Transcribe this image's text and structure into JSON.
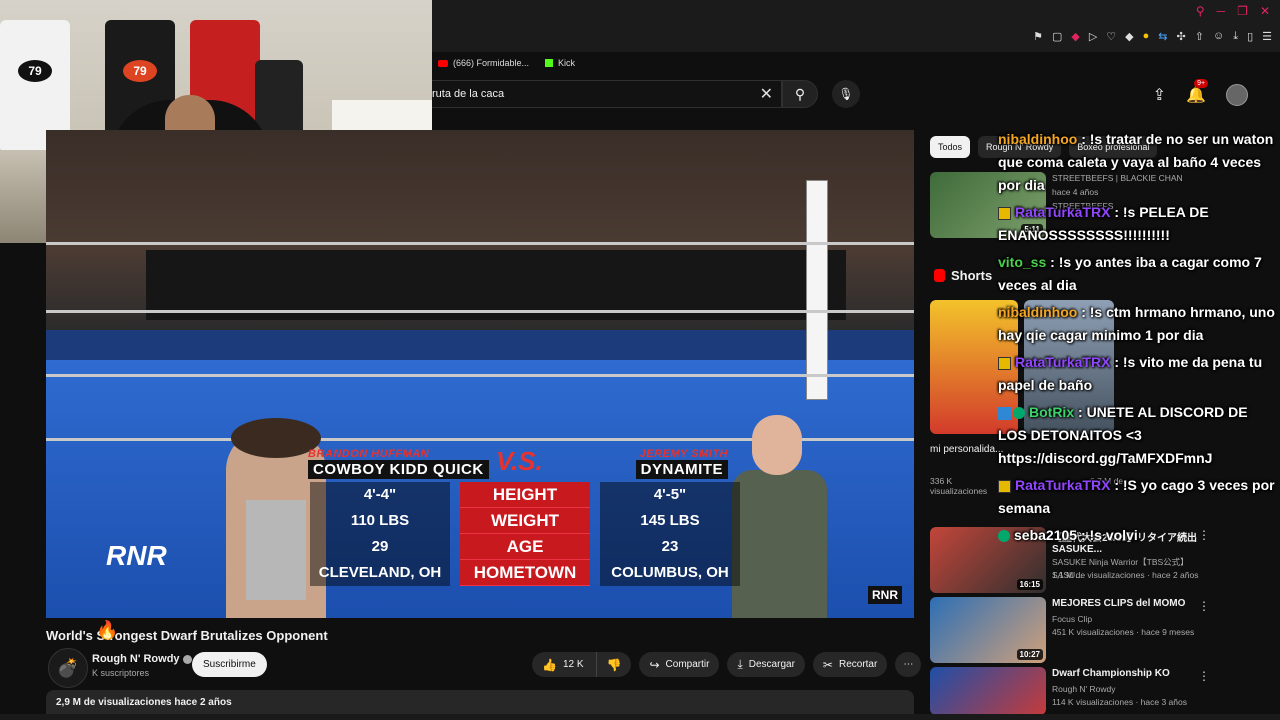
{
  "browser": {
    "bookmarks": [
      {
        "label": "(666) Formidable..."
      },
      {
        "label": "Kick"
      }
    ]
  },
  "header": {
    "search_value": "ruta de la caca",
    "notif_count": "9+"
  },
  "video": {
    "overlay": {
      "left_first": "BRANDON HUFFMAN",
      "left_nick": "COWBOY KIDD QUICK",
      "vs": "V.S.",
      "right_first": "JEREMY SMITH",
      "right_nick": "DYNAMITE",
      "left_stats": [
        "4'-4\"",
        "110 LBS",
        "29",
        "CLEVELAND, OH"
      ],
      "labels": [
        "HEIGHT",
        "WEIGHT",
        "AGE",
        "HOMETOWN"
      ],
      "right_stats": [
        "4'-5\"",
        "145 LBS",
        "23",
        "COLUMBUS, OH"
      ],
      "logo": "RNR",
      "corner_logo": "RNR"
    },
    "title": "World's Strongest Dwarf Brutalizes Opponent",
    "channel": "Rough N' Rowdy",
    "subscribers": "K suscriptores",
    "subscribe_label": "Suscribirme",
    "likes": "12 K",
    "share_label": "Compartir",
    "download_label": "Descargar",
    "clip_label": "Recortar",
    "views_line": "2,9 M de visualizaciones  hace 2 años"
  },
  "sidebar": {
    "chips": [
      "Todos",
      "Rough N' Rowdy",
      "Boxeo profesional"
    ],
    "rec_top": {
      "channel": "STREETBEEFS | BLACKIE CHAN",
      "channel2": "STREETBEEFS",
      "meta": "hace 4 años",
      "duration": "5:11"
    },
    "shorts_label": "Shorts",
    "short_left": {
      "title": "mi personalida...",
      "meta": "336 K visualizaciones"
    },
    "short_right": {
      "meta": "6,7 M de"
    },
    "recs": [
      {
        "title": "【歴代大会26/39】リタイア続出 SASUKE...",
        "channel": "SASUKE Ninja Warrior【TBS公式】SASU...",
        "meta": "1,1 M de visualizaciones · hace 2 años",
        "duration": "16:15"
      },
      {
        "title": "MEJORES CLIPS del MOMO",
        "channel": "Focus Clip",
        "meta": "451 K visualizaciones · hace 9 meses",
        "duration": "10:27"
      },
      {
        "title": "Dwarf Championship KO",
        "channel": "Rough N' Rowdy",
        "meta": "114 K visualizaciones · hace 3 años",
        "duration": ""
      }
    ]
  },
  "chat": [
    {
      "user": "nibaldinhoo",
      "text": " : !s tratar de no ser un waton que coma caleta y vaya al baño 4 veces por dia",
      "color": "#f5a623",
      "badge": "none"
    },
    {
      "user": "RataTurkaTRX",
      "text": " : !s PELEA DE ENANOSSSSSSSS!!!!!!!!!!",
      "color": "#9146ff",
      "badge": "square"
    },
    {
      "user": "vito_ss",
      "text": " : !s yo antes iba a cagar como 7 veces al dia",
      "color": "#48d14b",
      "badge": "none"
    },
    {
      "user": "nibaldinhoo",
      "text": " : !s ctm hrmano hrmano, uno hay qie cagar minimo 1 por dia",
      "color": "#f5a623",
      "badge": "none"
    },
    {
      "user": "RataTurkaTRX",
      "text": " : !s vito me da pena tu papel de baño",
      "color": "#9146ff",
      "badge": "square"
    },
    {
      "user": "BotRix",
      "text": " : UNETE AL DISCORD DE LOS DETONAITOS <3 https://discord.gg/TaMFXDFmnJ",
      "color": "#3bd46b",
      "badge": "bot"
    },
    {
      "user": "RataTurkaTRX",
      "text": " : !S yo cago 3 veces por semana",
      "color": "#9146ff",
      "badge": "square"
    },
    {
      "user": "seba2105",
      "text": " : !s volvi",
      "color": "#ffffff",
      "badge": "green"
    }
  ],
  "colors": {
    "accent_red": "#cc0000",
    "overlay_red": "#c8191f",
    "bg": "#0f0f0f"
  }
}
